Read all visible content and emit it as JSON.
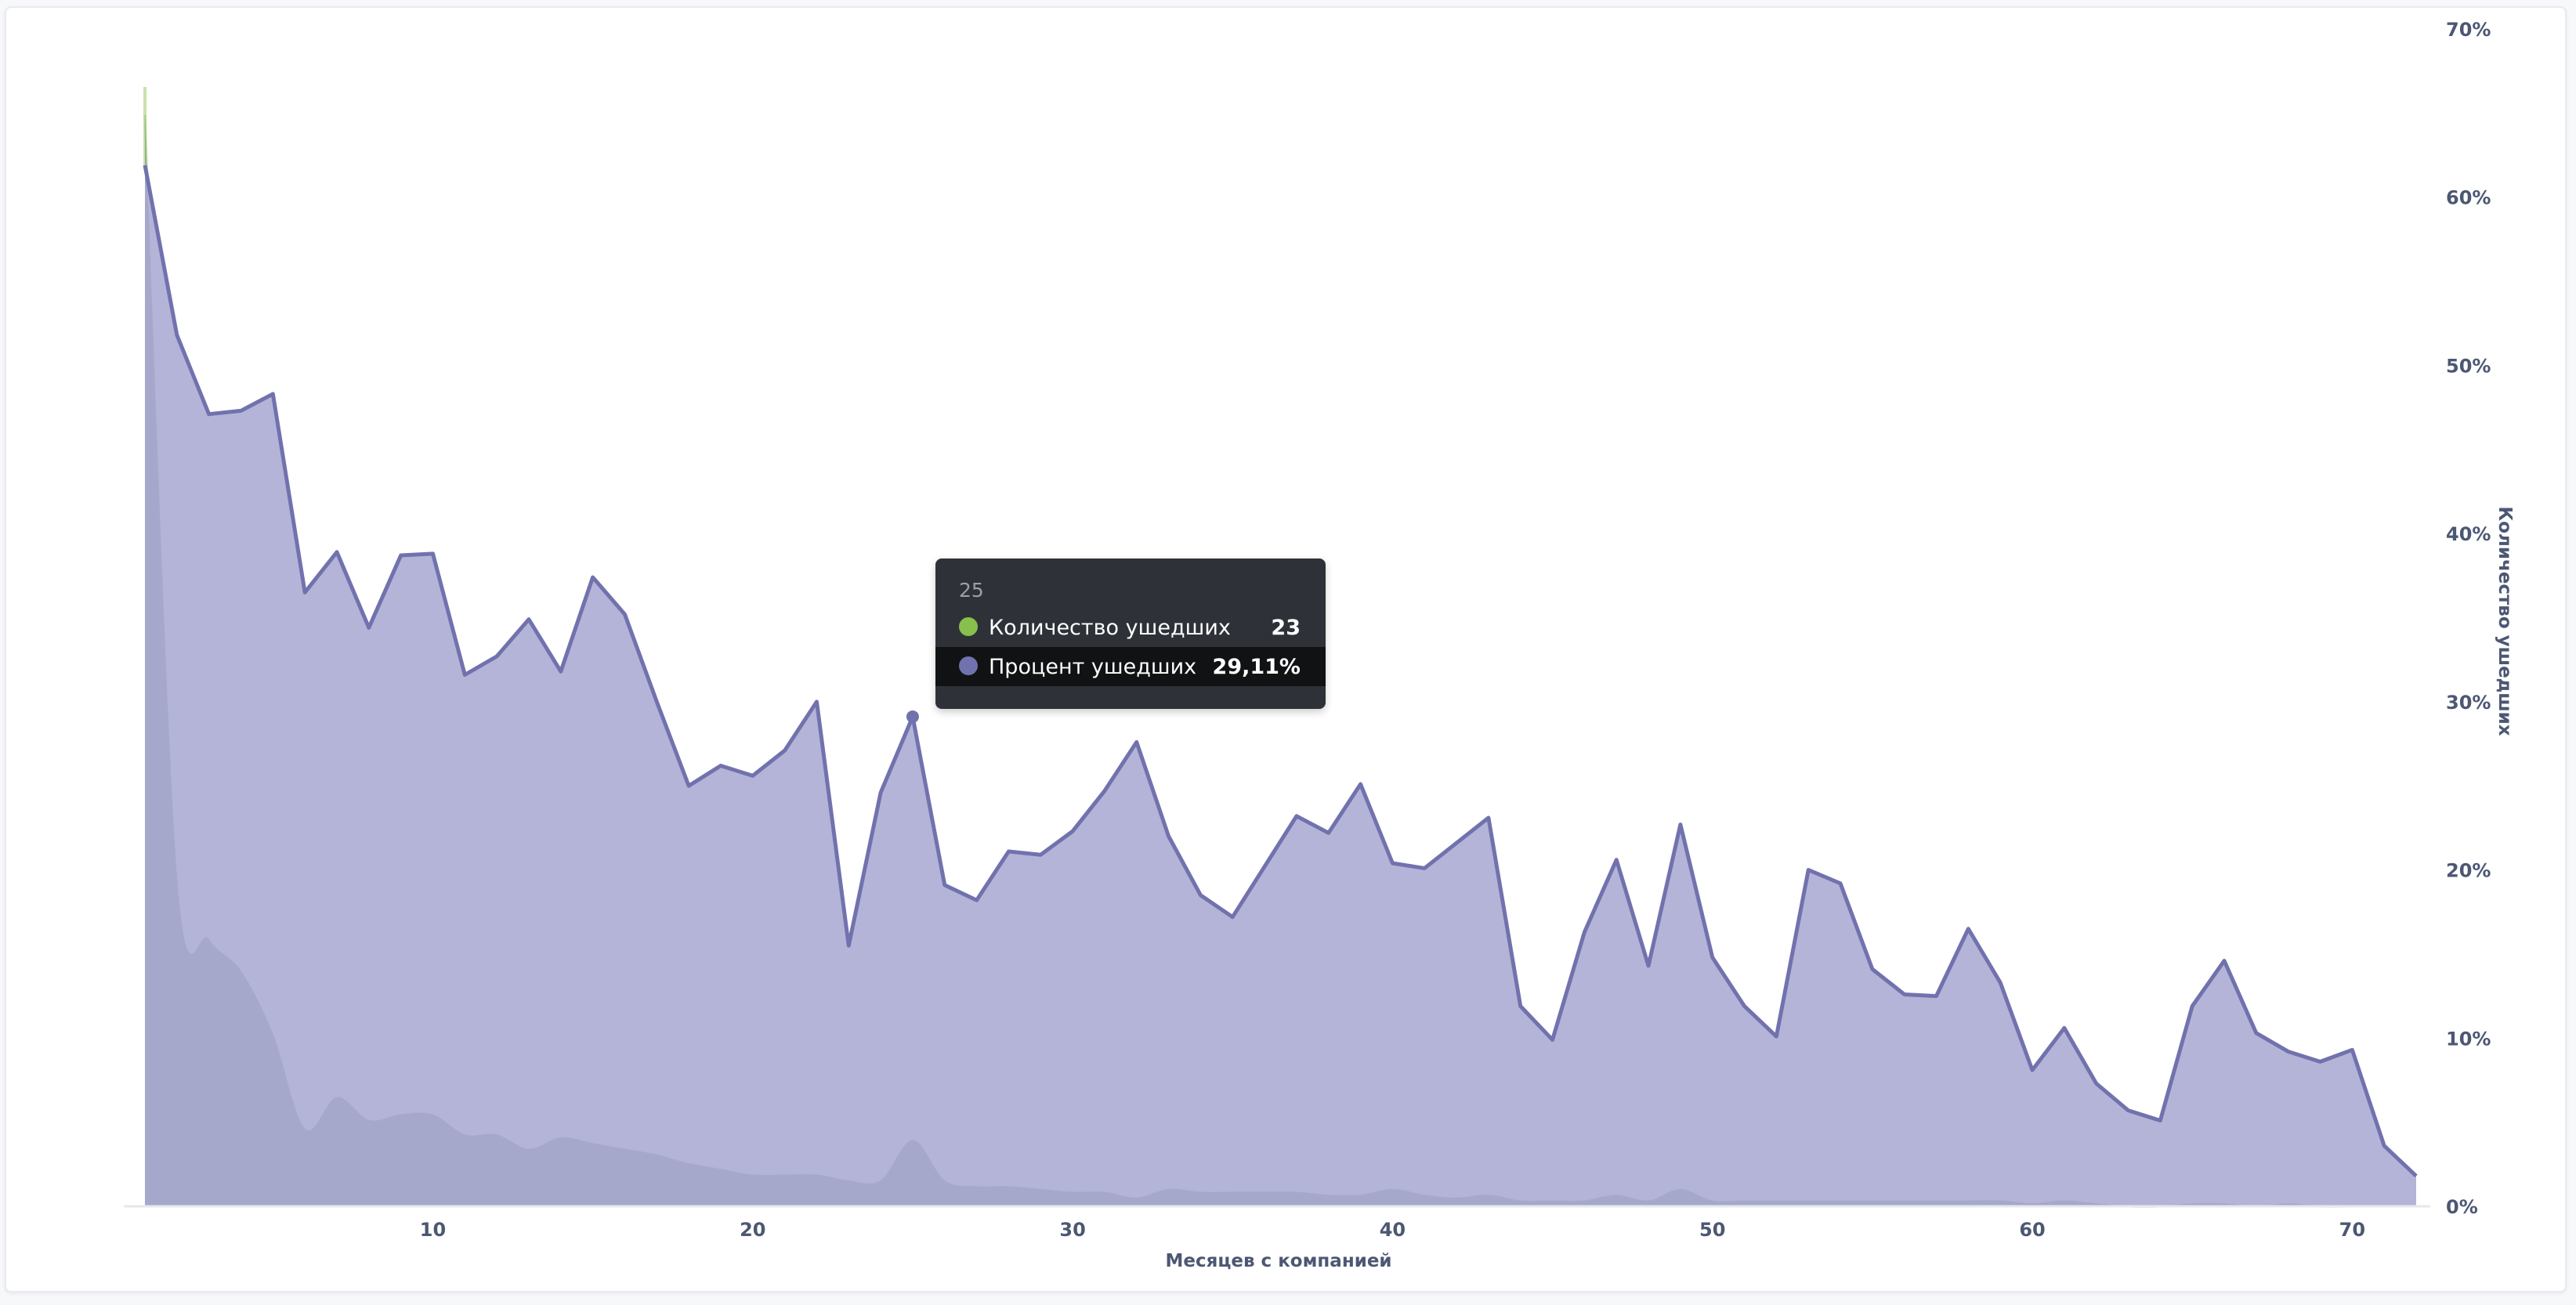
{
  "chart_data": {
    "type": "area",
    "xlabel": "Месяцев с компанией",
    "ylabel": "Количество ушедших",
    "x_range": [
      1,
      72
    ],
    "x_ticks": [
      "10",
      "20",
      "30",
      "40",
      "50",
      "60",
      "70"
    ],
    "y_range": [
      0,
      70
    ],
    "y_ticks": [
      "0%",
      "10%",
      "20%",
      "30%",
      "40%",
      "50%",
      "60%",
      "70%"
    ],
    "grid": false,
    "series": [
      {
        "name": "Процент ушедших",
        "color": "#7172ad",
        "fill": "#b0b0d6",
        "x": [
          1,
          2,
          3,
          4,
          5,
          6,
          7,
          8,
          9,
          10,
          11,
          12,
          13,
          14,
          15,
          16,
          17,
          18,
          19,
          20,
          21,
          22,
          23,
          24,
          25,
          26,
          27,
          28,
          29,
          30,
          31,
          32,
          33,
          34,
          35,
          36,
          37,
          38,
          39,
          40,
          41,
          42,
          43,
          44,
          45,
          46,
          47,
          48,
          49,
          50,
          51,
          52,
          53,
          54,
          55,
          56,
          57,
          58,
          59,
          60,
          61,
          62,
          63,
          64,
          65,
          66,
          67,
          68,
          69,
          70,
          71,
          72
        ],
        "values": [
          61.9,
          51.8,
          47.1,
          47.3,
          48.3,
          36.5,
          38.9,
          34.4,
          38.7,
          38.8,
          31.6,
          32.7,
          34.9,
          31.8,
          37.4,
          35.2,
          30.0,
          25.0,
          26.2,
          25.6,
          27.1,
          30.0,
          15.5,
          24.6,
          29.11,
          19.1,
          18.2,
          21.1,
          20.9,
          22.3,
          24.7,
          27.6,
          22.0,
          18.5,
          17.2,
          20.2,
          23.2,
          22.2,
          25.1,
          20.4,
          20.1,
          21.6,
          23.1,
          11.9,
          9.9,
          16.3,
          20.6,
          14.3,
          22.7,
          14.8,
          11.9,
          10.1,
          20.0,
          19.2,
          14.1,
          12.6,
          12.5,
          16.5,
          13.3,
          8.1,
          10.6,
          7.3,
          5.7,
          5.1,
          11.9,
          14.6,
          10.3,
          9.2,
          8.6,
          9.3,
          3.6,
          1.8
        ]
      },
      {
        "name": "Количество ушедших",
        "color": "#88bf4d",
        "fill": "#a3a9c6",
        "x": [
          1,
          2,
          3,
          4,
          5,
          6,
          7,
          8,
          9,
          10,
          11,
          12,
          13,
          14,
          15,
          16,
          17,
          18,
          19,
          20,
          21,
          22,
          23,
          24,
          25,
          26,
          27,
          28,
          29,
          30,
          31,
          32,
          33,
          34,
          35,
          36,
          37,
          38,
          39,
          40,
          41,
          42,
          43,
          44,
          45,
          46,
          47,
          48,
          49,
          50,
          51,
          52,
          53,
          54,
          55,
          56,
          57,
          58,
          59,
          60,
          61,
          62,
          63,
          64,
          65,
          66,
          67,
          68,
          69,
          70,
          71,
          72
        ],
        "values": [
          380,
          115,
          93,
          82,
          60,
          27,
          38,
          30,
          32,
          32,
          25,
          25,
          20,
          24,
          22,
          20,
          18,
          15,
          13,
          11,
          11,
          11,
          9,
          9,
          23,
          9,
          7,
          7,
          6,
          5,
          5,
          3,
          6,
          5,
          5,
          5,
          5,
          4,
          4,
          6,
          4,
          3,
          4,
          2,
          2,
          2,
          4,
          2,
          6,
          2,
          2,
          2,
          2,
          2,
          2,
          2,
          2,
          2,
          2,
          1,
          2,
          1,
          0,
          0,
          1,
          1,
          0,
          1,
          0,
          0,
          0,
          0
        ]
      }
    ],
    "tooltip": {
      "x": "25",
      "rows": [
        {
          "label": "Количество ушедших",
          "value": "23",
          "color": "#88bf4d"
        },
        {
          "label": "Процент ушедших",
          "value": "29,11%",
          "color": "#7172ad"
        }
      ]
    }
  }
}
